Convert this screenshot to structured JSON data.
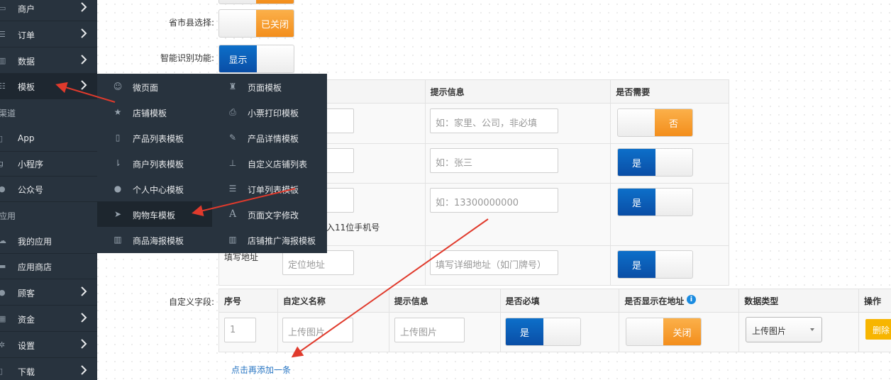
{
  "sidebar": {
    "items": [
      {
        "label": "商户",
        "icon": "shop-icon",
        "has_chevron": true
      },
      {
        "label": "订单",
        "icon": "order-icon",
        "has_chevron": true
      },
      {
        "label": "数据",
        "icon": "chart-icon",
        "has_chevron": true
      },
      {
        "label": "模板",
        "icon": "list-icon",
        "has_chevron": true
      },
      {
        "label": "App",
        "icon": "mobile-icon",
        "has_chevron": false
      },
      {
        "label": "小程序",
        "icon": "miniapp-icon",
        "has_chevron": false
      },
      {
        "label": "公众号",
        "icon": "wechat-icon",
        "has_chevron": false
      },
      {
        "label": "我的应用",
        "icon": "cloud-icon",
        "has_chevron": false
      },
      {
        "label": "应用商店",
        "icon": "store-icon",
        "has_chevron": false
      },
      {
        "label": "顾客",
        "icon": "users-icon",
        "has_chevron": true
      },
      {
        "label": "资金",
        "icon": "grid-icon",
        "has_chevron": true
      },
      {
        "label": "设置",
        "icon": "gear-icon",
        "has_chevron": true
      },
      {
        "label": "下载",
        "icon": "download-icon",
        "has_chevron": true
      }
    ],
    "sections": [
      "渠道",
      "应用"
    ]
  },
  "flyout": {
    "left": [
      {
        "label": "微页面",
        "icon": "smile-icon"
      },
      {
        "label": "店铺模板",
        "icon": "star-icon"
      },
      {
        "label": "产品列表模板",
        "icon": "phone-icon"
      },
      {
        "label": "商户列表模板",
        "icon": "sort-icon"
      },
      {
        "label": "个人中心模板",
        "icon": "user-icon"
      },
      {
        "label": "购物车模板",
        "icon": "arrow-icon"
      },
      {
        "label": "商品海报模板",
        "icon": "bar-chart-icon"
      }
    ],
    "right": [
      {
        "label": "页面模板",
        "icon": "trophy-icon"
      },
      {
        "label": "小票打印模板",
        "icon": "printer-icon"
      },
      {
        "label": "产品详情模板",
        "icon": "pencil-icon"
      },
      {
        "label": "自定义店铺列表",
        "icon": "sitemap-icon"
      },
      {
        "label": "订单列表模板",
        "icon": "list-alt-icon"
      },
      {
        "label": "页面文字修改",
        "icon": "font-icon"
      },
      {
        "label": "店铺推广海报模板",
        "icon": "bar-chart-icon"
      }
    ]
  },
  "form": {
    "region_label": "省市县选择:",
    "region_toggle": "已关闭",
    "smart_label": "智能识别功能:",
    "smart_toggle": "显示",
    "table1": {
      "headers": [
        "提示信息",
        "是否需要"
      ],
      "rows": [
        {
          "hint_placeholder": "如：家里、公司，非必填",
          "toggle": "否",
          "state": "off"
        },
        {
          "hint_placeholder": "如：张三",
          "toggle": "是",
          "state": "on"
        },
        {
          "hint_placeholder": "如：13300000000",
          "toggle": "是",
          "state": "on",
          "note": "入11位手机号"
        },
        {
          "name_label": "填写地址",
          "name_placeholder": "定位地址",
          "hint_placeholder": "填写详细地址（如门牌号）",
          "toggle": "是",
          "state": "on"
        }
      ]
    },
    "custom_label": "自定义字段:",
    "table2": {
      "headers": [
        "序号",
        "自定义名称",
        "提示信息",
        "是否必填",
        "是否显示在地址",
        "数据类型",
        "操作"
      ],
      "row": {
        "index": "1",
        "name_placeholder": "上传图片",
        "hint_placeholder": "上传图片",
        "required_toggle": "是",
        "show_toggle": "关闭",
        "data_type": "上传图片",
        "delete": "删除"
      }
    },
    "add_link": "点击再添加一条"
  },
  "colors": {
    "sidebar_bg": "#28333e",
    "toggle_on": "#0a5cb8",
    "toggle_off": "#f5a030",
    "annotation_arrow": "#e03a2c"
  }
}
